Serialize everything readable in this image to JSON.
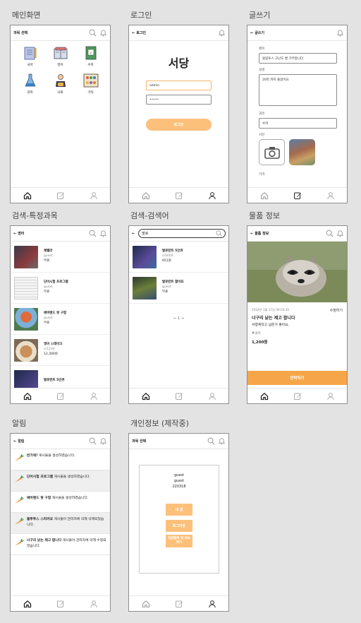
{
  "labels": {
    "main": "메인화면",
    "login": "로그인",
    "write": "글쓰기",
    "search_subject": "검색-특정과목",
    "search_word": "검색-검색어",
    "product": "물품 정보",
    "notice": "알림",
    "profile": "개인정보 (제작중)"
  },
  "main_screen": {
    "title": "과목 선택",
    "categories": [
      {
        "label": "국어"
      },
      {
        "label": "영어"
      },
      {
        "label": "수학"
      },
      {
        "label": "과학"
      },
      {
        "label": "사회"
      },
      {
        "label": "기타"
      }
    ]
  },
  "login_screen": {
    "back_label": "로그인",
    "app_name": "서당",
    "id_value": "admin",
    "pw_value": "•••••",
    "login_button": "로그인"
  },
  "write_screen": {
    "back_label": "글쓰기",
    "title_label": "제목",
    "title_value": "블링투스 고난도 쌘 기부합니다",
    "desc_label": "설명",
    "desc_value": "20쪽 까지 풀었어요",
    "subject_label": "과목",
    "subject_value": "수학",
    "photo_label": "사진",
    "price_label": "가격"
  },
  "subject_screen": {
    "back_label": "영어",
    "items": [
      {
        "title": "체벨라",
        "user": "guest",
        "price": "무료"
      },
      {
        "title": "단어시험 프로그램",
        "user": "guest",
        "price": "무료"
      },
      {
        "title": "에버랜드 랏 구함",
        "user": "guest",
        "price": "무료"
      },
      {
        "title": "영어 스테이크",
        "user": "sr1234",
        "price": "12,300원"
      },
      {
        "title": "발로란트 5인큐",
        "user": "",
        "price": ""
      }
    ]
  },
  "search_screen": {
    "query": "발로",
    "items": [
      {
        "title": "발로란트 5인큐",
        "user": "sr0000",
        "price": "651원"
      },
      {
        "title": "발로란트 할아요",
        "user": "guest",
        "price": "무료"
      }
    ],
    "page": "← 1 →"
  },
  "product_screen": {
    "back_label": "물품 정보",
    "date": "2018년 3월 17일 09:04:30",
    "edit": "수정하기",
    "title": "너구리 낡는 제고 팝니다",
    "desc": "서령제작고 넘은거 좋아요.",
    "tag": "#국어",
    "price": "1,200원",
    "contact_button": "연락하기"
  },
  "notice_screen": {
    "back_label": "알림",
    "items": [
      {
        "bold": "반가워!",
        "text": " 게시물을 생성하였습니다.",
        "hl": false
      },
      {
        "bold": "단어시험 프로그램",
        "text": " 게시물을 생성하였습니다.",
        "hl": true
      },
      {
        "bold": "에버랜드 랏 구함",
        "text": " 게시물을 생성하였습니다.",
        "hl": false
      },
      {
        "bold": "블루투스 스피커요",
        "text": " 게시물이 관리자에 의해 삭제되었습니다.",
        "hl": true
      },
      {
        "bold": "너구리 낡는 제고 팝니다",
        "text": " 게시물이 관리자에 의해 수정되었습니다.",
        "hl": false
      }
    ]
  },
  "profile_screen": {
    "title": "과목 선택",
    "name": "guest",
    "nick": "guest",
    "number": "220318",
    "btn_my": "내 글",
    "btn_logout": "로그아웃",
    "btn_delete": "회원탈퇴 및 정보하기"
  },
  "colors": {
    "accent": "#fcc07b",
    "contact": "#f6a649"
  }
}
